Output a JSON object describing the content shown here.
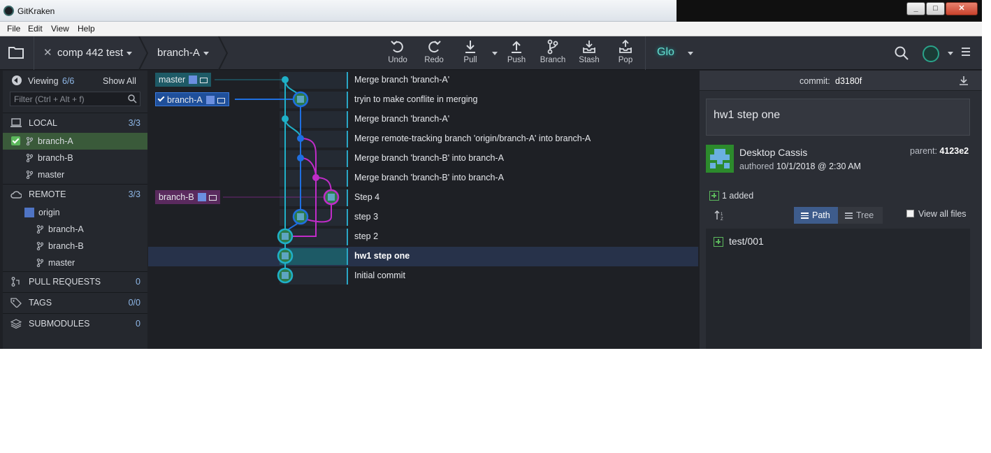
{
  "window": {
    "title": "GitKraken"
  },
  "menu": [
    "File",
    "Edit",
    "View",
    "Help"
  ],
  "toolbar": {
    "repo": "comp 442 test",
    "branch": "branch-A",
    "actions": [
      {
        "label": "Undo",
        "icon": "undo-icon"
      },
      {
        "label": "Redo",
        "icon": "redo-icon"
      },
      {
        "label": "Pull",
        "icon": "pull-icon"
      },
      {
        "label": "Push",
        "icon": "push-icon"
      },
      {
        "label": "Branch",
        "icon": "branch-icon"
      },
      {
        "label": "Stash",
        "icon": "stash-icon"
      },
      {
        "label": "Pop",
        "icon": "pop-icon"
      }
    ],
    "glo": "Glo"
  },
  "sidebar": {
    "viewing_label": "Viewing",
    "viewing_count": "6/6",
    "show_all": "Show All",
    "filter_placeholder": "Filter (Ctrl + Alt + f)",
    "local": {
      "label": "LOCAL",
      "count": "3/3",
      "branches": [
        "branch-A",
        "branch-B",
        "master"
      ]
    },
    "remote": {
      "label": "REMOTE",
      "count": "3/3",
      "origin": "origin",
      "branches": [
        "branch-A",
        "branch-B",
        "master"
      ]
    },
    "pull_requests": {
      "label": "PULL REQUESTS",
      "count": "0"
    },
    "tags": {
      "label": "TAGS",
      "count": "0/0"
    },
    "submodules": {
      "label": "SUBMODULES",
      "count": "0"
    }
  },
  "graph": {
    "refs": {
      "master": "master",
      "branch_a": "branch-A",
      "branch_b": "branch-B"
    },
    "commits": [
      "Merge branch 'branch-A'",
      "tryin to make conflite in merging",
      "Merge branch 'branch-A'",
      "Merge remote-tracking branch 'origin/branch-A' into branch-A",
      "Merge branch 'branch-B' into branch-A",
      "Merge branch 'branch-B' into branch-A",
      "Step 4",
      "step 3",
      "step 2",
      "hw1 step one",
      "Initial commit"
    ],
    "colors": {
      "teal": "#1fb0c8",
      "blue": "#1f6fe0",
      "magenta": "#c02cc8"
    }
  },
  "detail": {
    "commit_label": "commit:",
    "commit_hash": "d3180f",
    "summary": "hw1 step one",
    "author": "Desktop Cassis",
    "authored_label": "authored",
    "authored_date": "10/1/2018 @ 2:30 AM",
    "parent_label": "parent:",
    "parent_hash": "4123e2",
    "added": "1 added",
    "view_path": "Path",
    "view_tree": "Tree",
    "view_all_files": "View all files",
    "files": [
      "test/001"
    ]
  }
}
